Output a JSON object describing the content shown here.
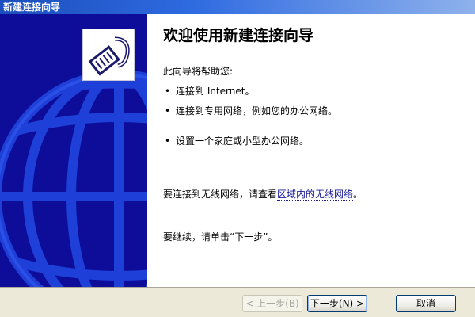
{
  "window": {
    "title": "新建连接向导"
  },
  "main": {
    "heading": "欢迎使用新建连接向导",
    "intro": "此向导将帮助您:",
    "bullets": [
      "连接到 Internet。",
      "连接到专用网络，例如您的办公网络。",
      "设置一个家庭或小型办公网络。"
    ],
    "wireless_prefix": "要连接到无线网络，请查看",
    "wireless_link": "区域内的无线网络",
    "wireless_suffix": "。",
    "continue_text": "要继续，请单击“下一步”。"
  },
  "buttons": {
    "back": "< 上一步(B)",
    "next": "下一步(N) >",
    "cancel": "取消"
  },
  "colors": {
    "left_panel": "#0d0d9a",
    "title_bar": "#2e6ae0",
    "button_bar": "#ece9d8"
  },
  "icons": {
    "wizard": "network-cable-icon",
    "globe": "globe-watermark"
  }
}
